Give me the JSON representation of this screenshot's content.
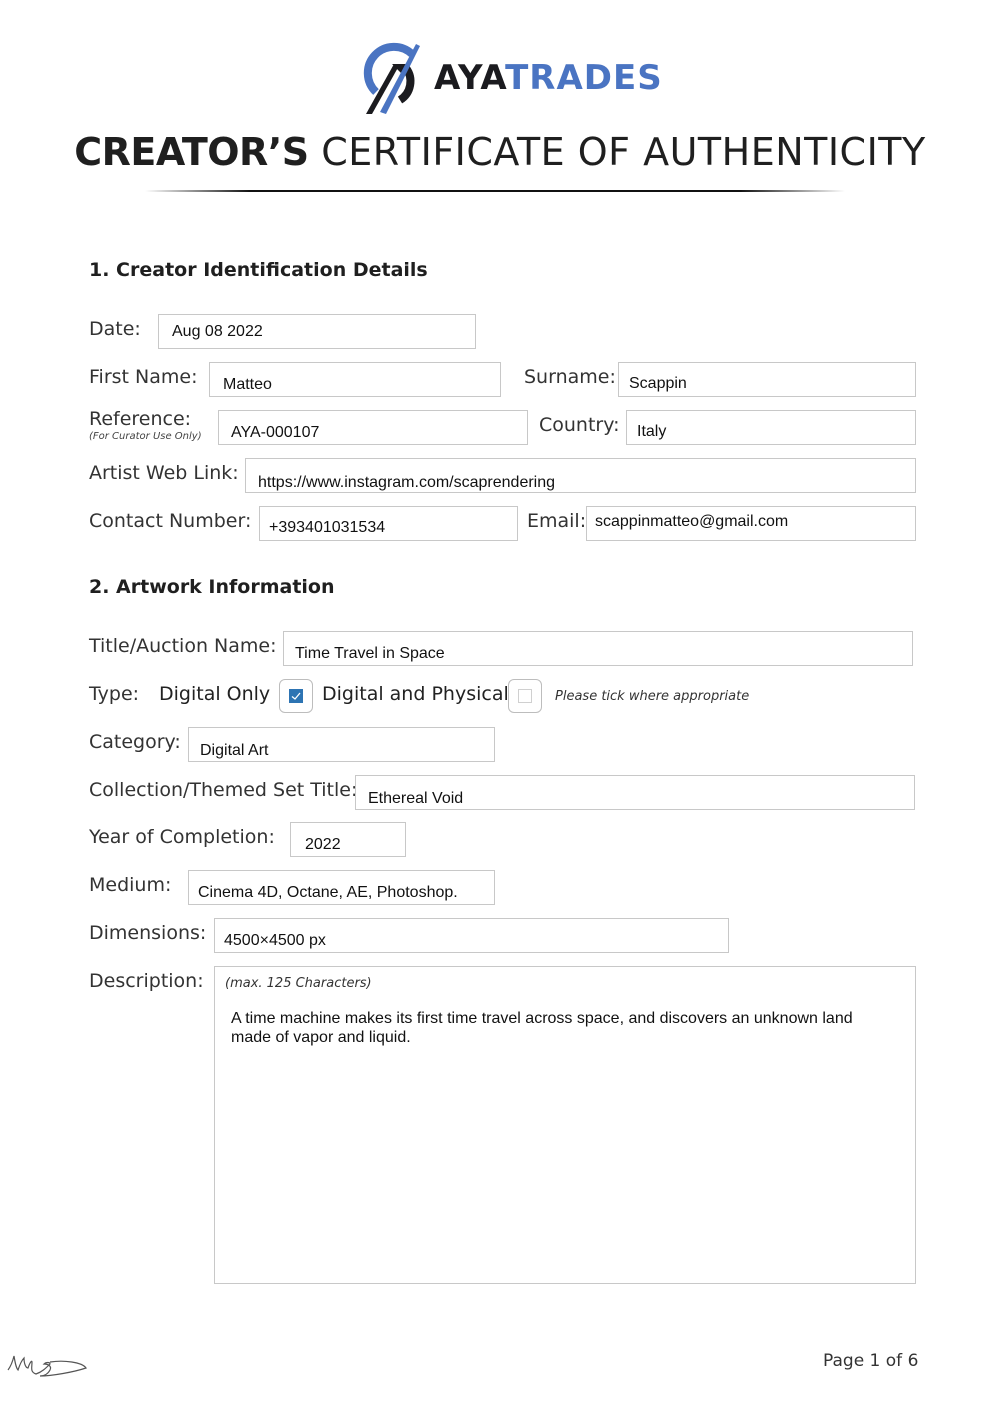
{
  "brand": {
    "name_dark": "AYA",
    "name_blue": "TRADES",
    "colors": {
      "dark": "#1b1b1f",
      "blue": "#4a74c2",
      "checkbox": "#2d74b3"
    }
  },
  "header": {
    "title_bold": "CREATOR’S",
    "title_light": "CERTIFICATE OF AUTHENTICITY"
  },
  "section1": {
    "heading": "1. Creator Identification Details",
    "date": {
      "label": "Date:",
      "value": "Aug 08 2022"
    },
    "first_name": {
      "label": "First Name:",
      "value": "Matteo"
    },
    "surname": {
      "label": "Surname:",
      "value": "Scappin"
    },
    "reference": {
      "label": "Reference:",
      "sublabel": "(For Curator Use Only)",
      "value": "AYA-000107"
    },
    "country": {
      "label": "Country:",
      "value": "Italy"
    },
    "web_link": {
      "label": "Artist Web Link:",
      "value": "https://www.instagram.com/scaprendering"
    },
    "contact": {
      "label": "Contact Number:",
      "value": "+393401031534"
    },
    "email": {
      "label": "Email:",
      "value": "scappinmatteo@gmail.com"
    }
  },
  "section2": {
    "heading": "2. Artwork Information",
    "title": {
      "label": "Title/Auction Name:",
      "value": "Time Travel in Space"
    },
    "type": {
      "label": "Type:",
      "options": [
        {
          "label": "Digital Only",
          "checked": true
        },
        {
          "label": "Digital and Physical",
          "checked": false
        }
      ],
      "hint": "Please tick where appropriate"
    },
    "category": {
      "label": "Category:",
      "value": "Digital Art"
    },
    "collection": {
      "label": "Collection/Themed Set Title:",
      "value": "Ethereal Void"
    },
    "year": {
      "label": "Year of Completion:",
      "value": "2022"
    },
    "medium": {
      "label": "Medium:",
      "value": "Cinema 4D, Octane, AE, Photoshop."
    },
    "dimensions": {
      "label": "Dimensions:",
      "value": "4500×4500 px"
    },
    "description": {
      "label": "Description:",
      "hint": "(max. 125 Characters)",
      "value": "A time machine makes its first time travel across space, and discovers an unknown land made of vapor and liquid."
    }
  },
  "footer": {
    "page": "Page 1 of 6"
  }
}
